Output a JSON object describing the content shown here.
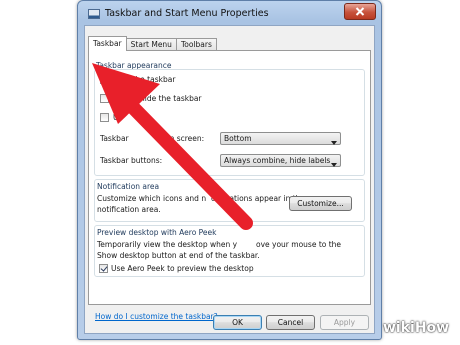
{
  "window": {
    "title": "Taskbar and Start Menu Properties"
  },
  "tabs": [
    {
      "label": "Taskbar",
      "active": true
    },
    {
      "label": "Start Menu",
      "active": false
    },
    {
      "label": "Toolbars",
      "active": false
    }
  ],
  "taskbar_appearance": {
    "title": "Taskbar appearance",
    "lock_label": "Lock the taskbar",
    "lock_checked": false,
    "autohide_label_visible": "A",
    "autohide_label_end": "hide the taskbar",
    "autohide_checked": false,
    "small_icons_label_visible": "U",
    "small_icons_checked": false,
    "location_label_start": "Taskbar",
    "location_label_end": "on screen:",
    "location_value": "Bottom",
    "buttons_label": "Taskbar buttons:",
    "buttons_value": "Always combine, hide labels"
  },
  "notification_area": {
    "title": "Notification area",
    "text_line1_start": "Customize which icons and n",
    "text_line1_end": "otifications appear in the",
    "text_line2": "notification area.",
    "customize_button": "Customize..."
  },
  "aero_peek": {
    "title": "Preview desktop with Aero Peek",
    "text_line1_start": "Temporarily view the desktop when y",
    "text_line1_end": "ove your mouse to the",
    "text_line2": "Show desktop button at end of the taskbar.",
    "checkbox_label": "Use Aero Peek to preview the desktop",
    "checkbox_checked": true
  },
  "help_link": "How do I customize the taskbar?",
  "buttons": {
    "ok": "OK",
    "cancel": "Cancel",
    "apply": "Apply"
  },
  "overlay": {
    "arrow_color": "#e8202a"
  },
  "watermark": {
    "wiki": "wiki",
    "how": "How"
  }
}
